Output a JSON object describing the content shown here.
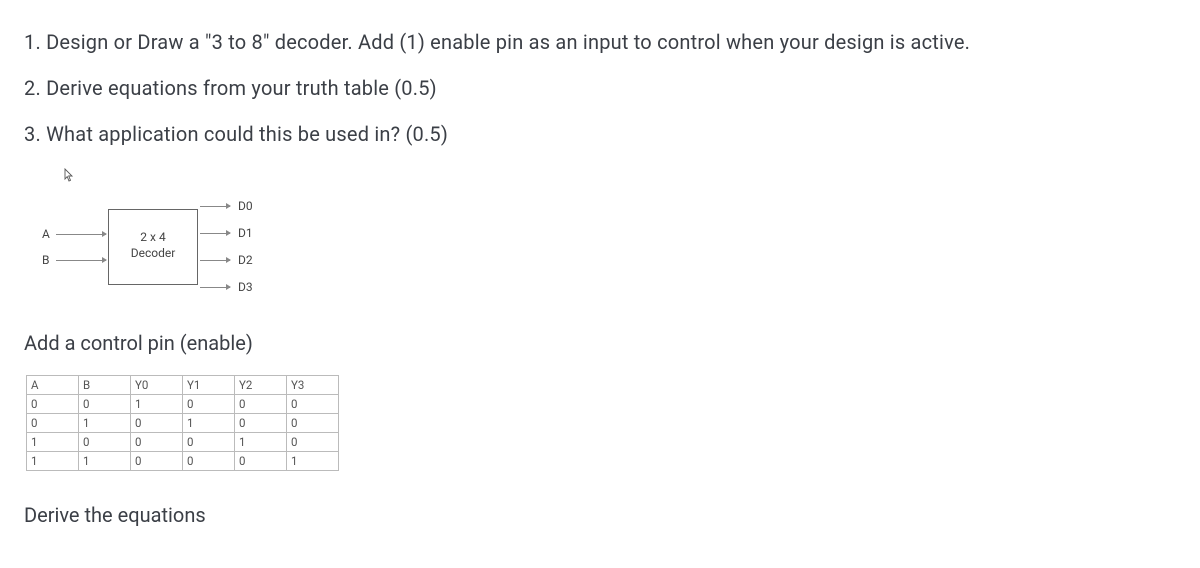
{
  "questions": {
    "q1": "1. Design or Draw a \"3 to 8\" decoder. Add (1) enable pin as an input to control when your design is active.",
    "q2": "2. Derive equations from your truth table (0.5)",
    "q3": "3. What application could this be used in? (0.5)"
  },
  "diagram": {
    "cursor_glyph": "↖",
    "input_a": "A",
    "input_b": "B",
    "box_line1": "2 x 4",
    "box_line2": "Decoder",
    "output_d0": "D0",
    "output_d1": "D1",
    "output_d2": "D2",
    "output_d3": "D3"
  },
  "subheading_enable": "Add a control pin (enable)",
  "truth_table": {
    "headers": [
      "A",
      "B",
      "Y0",
      "Y1",
      "Y2",
      "Y3"
    ],
    "rows": [
      [
        "0",
        "0",
        "1",
        "0",
        "0",
        "0"
      ],
      [
        "0",
        "1",
        "0",
        "1",
        "0",
        "0"
      ],
      [
        "1",
        "0",
        "0",
        "0",
        "1",
        "0"
      ],
      [
        "1",
        "1",
        "0",
        "0",
        "0",
        "1"
      ]
    ]
  },
  "derive_heading": "Derive the equations"
}
